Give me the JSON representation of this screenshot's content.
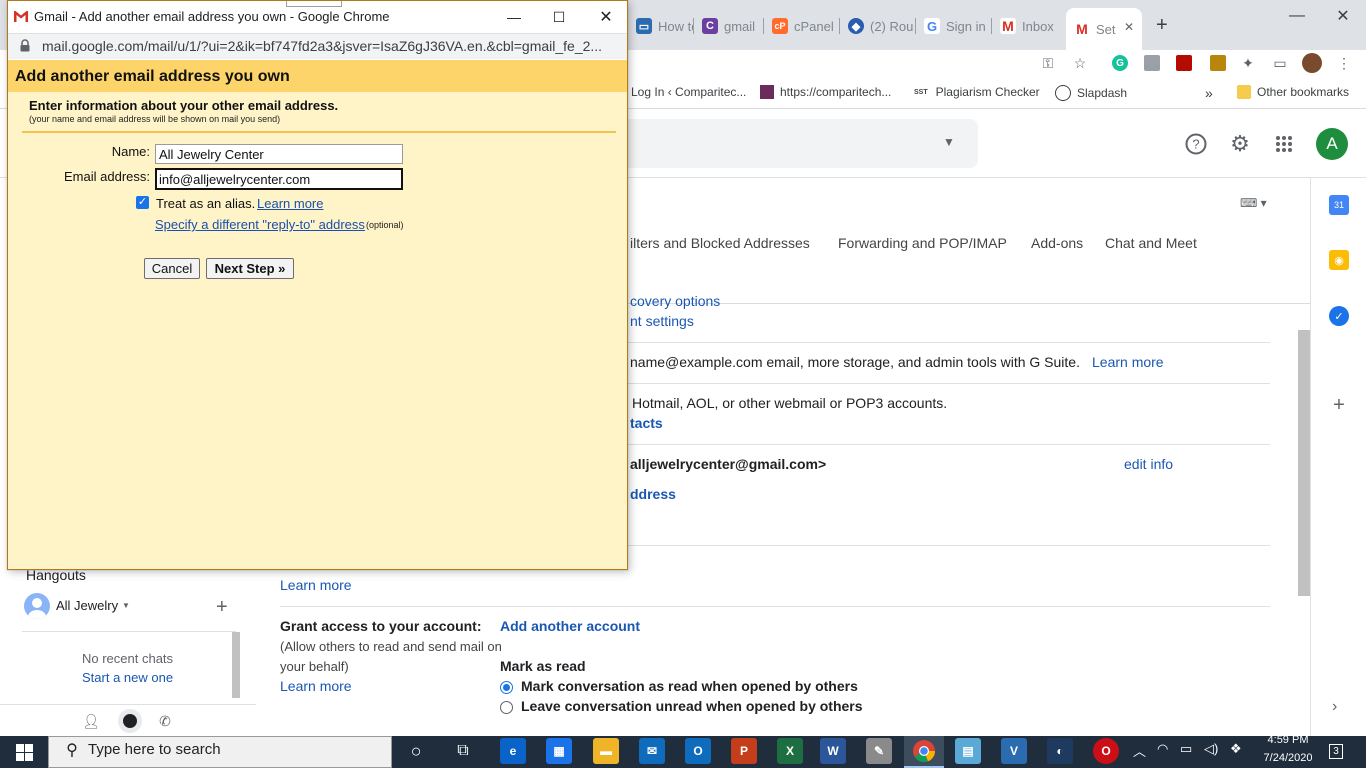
{
  "background_browser": {
    "tabs": [
      {
        "label": "How to",
        "icon": "monitor-icon",
        "color": "#2b6cb0"
      },
      {
        "label": "gmail",
        "icon": "c-icon",
        "color": "#6b3fa0"
      },
      {
        "label": "cPanel",
        "icon": "cpanel-icon",
        "color": "#ff6c2c"
      },
      {
        "label": "(2) Rou",
        "icon": "diamond-icon",
        "color": "#2a5db0"
      },
      {
        "label": "Sign in",
        "icon": "google-icon",
        "color": "#4285f4"
      },
      {
        "label": "Inbox",
        "icon": "gmail-icon",
        "color": "#d93025"
      },
      {
        "label": "Set",
        "icon": "gmail-icon",
        "color": "#d93025"
      }
    ],
    "new_tab_symbol": "+",
    "bookmarks": [
      {
        "label": "Log In ‹ Comparitec..."
      },
      {
        "label": "https://comparitech..."
      },
      {
        "label": "Plagiarism Checker",
        "prefix": "SST"
      },
      {
        "label": "Slapdash"
      }
    ],
    "bookmarks_overflow": "»",
    "other_bookmarks": "Other bookmarks"
  },
  "gmail": {
    "avatar_letter": "A",
    "settings_tabs": [
      "ilters and Blocked Addresses",
      "Forwarding and POP/IMAP",
      "Add-ons",
      "Chat and Meet"
    ],
    "rows": {
      "recovery_options": "covery options",
      "account_settings": "nt settings",
      "gsuite_text": "name@example.com email, more storage, and admin tools with G Suite.",
      "gsuite_learn_more": "Learn more",
      "import_text": "Hotmail, AOL, or other webmail or POP3 accounts.",
      "import_contacts": "tacts",
      "send_as_address": "alljewelrycenter@gmail.com>",
      "edit_info": "edit info",
      "add_address": "ddress",
      "check_mail_learn_more": "Learn more",
      "grant_access_title": "Grant access to your account:",
      "grant_access_desc_1": "(Allow others to read and send mail on",
      "grant_access_desc_2": "your behalf)",
      "grant_access_learn_more": "Learn more",
      "add_another_account": "Add another account",
      "mark_as_read_title": "Mark as read",
      "mark_option_1": "Mark conversation as read when opened by others",
      "mark_option_2": "Leave conversation unread when opened by others",
      "mark_selected": 1
    }
  },
  "hangouts": {
    "title": "Hangouts",
    "user": "All Jewelry",
    "no_recent": "No recent chats",
    "start_new": "Start a new one"
  },
  "popup": {
    "window_title": "Gmail - Add another email address you own - Google Chrome",
    "url": "mail.google.com/mail/u/1/?ui=2&ik=bf747fd2a3&jsver=IsaZ6gJ36VA.en.&cbl=gmail_fe_2...",
    "dialog_title": "Add another email address you own",
    "subheading": "Enter information about your other email address.",
    "note": "(your name and email address will be shown on mail you send)",
    "name_label": "Name:",
    "name_value": "All Jewelry Center",
    "email_label": "Email address:",
    "email_value": "info@alljewelrycenter.com",
    "alias_checked": true,
    "alias_label": "Treat as an alias.",
    "alias_learn_more": "Learn more",
    "reply_to_link": "Specify a different \"reply-to\" address",
    "reply_to_optional": "(optional)",
    "cancel_label": "Cancel",
    "next_label": "Next Step »",
    "colors": {
      "header": "#fcd46a",
      "body": "#fff4c8",
      "rule": "#f0c34f"
    }
  },
  "taskbar": {
    "search_placeholder": "Type here to search",
    "time": "4:59 PM",
    "date": "7/24/2020",
    "notifications": "3"
  }
}
